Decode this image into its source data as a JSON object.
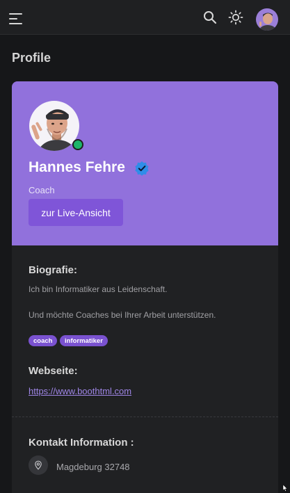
{
  "header": {
    "menu_icon": "hamburger-menu-icon",
    "search_icon": "search-icon",
    "theme_icon": "sun-icon"
  },
  "page": {
    "title": "Profile"
  },
  "profile": {
    "name": "Hannes Fehre",
    "verified_icon": "verified-check-icon",
    "role": "Coach",
    "status_color": "#1db56a",
    "accent_color": "#9171dc",
    "live_button_label": "zur Live-Ansicht"
  },
  "biography": {
    "heading": "Biografie:",
    "line1": "Ich bin Informatiker aus Leidenschaft.",
    "line2": "Und möchte Coaches bei Ihrer Arbeit unterstützen.",
    "tags": [
      "coach",
      "informatiker"
    ]
  },
  "website": {
    "heading": "Webseite:",
    "url": "https://www.boothtml.com"
  },
  "contact": {
    "heading": "Kontakt Information :",
    "location_icon": "map-pin-icon",
    "location": "Magdeburg 32748"
  }
}
